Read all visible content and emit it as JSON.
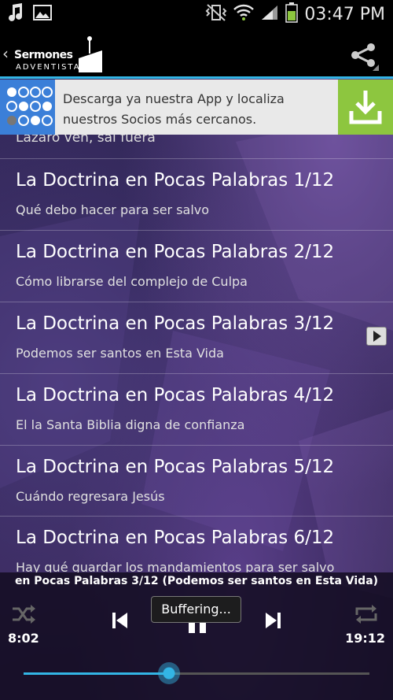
{
  "status_bar": {
    "time": "03:47 PM"
  },
  "action_bar": {
    "logo_line1": "Sermones",
    "logo_line2": "ADVENTISTAS"
  },
  "ad_banner": {
    "text": "Descarga ya nuestra App y localiza nuestros Socios más cercanos."
  },
  "list": {
    "partial_item_subtitle": "Lázaro ven, sal fuera",
    "items": [
      {
        "title": "La Doctrina en Pocas Palabras 1/12",
        "subtitle": "Qué debo hacer para ser salvo"
      },
      {
        "title": "La Doctrina en Pocas Palabras 2/12",
        "subtitle": "Cómo librarse del complejo de Culpa"
      },
      {
        "title": "La Doctrina en Pocas Palabras 3/12",
        "subtitle": "Podemos ser santos en Esta Vida"
      },
      {
        "title": "La Doctrina en Pocas Palabras 4/12",
        "subtitle": "El la Santa Biblia digna de confianza"
      },
      {
        "title": "La Doctrina en Pocas Palabras 5/12",
        "subtitle": "Cuándo regresara Jesús"
      },
      {
        "title": "La Doctrina en Pocas Palabras 6/12",
        "subtitle": "Hay qué guardar los mandamientos para ser salvo"
      }
    ]
  },
  "player": {
    "now_playing": "en Pocas Palabras 3/12 (Podemos ser santos en Esta Vida)",
    "elapsed": "8:02",
    "duration": "19:12",
    "toast": "Buffering...",
    "progress_fraction": 0.42,
    "accent_color": "#33b5e5"
  }
}
